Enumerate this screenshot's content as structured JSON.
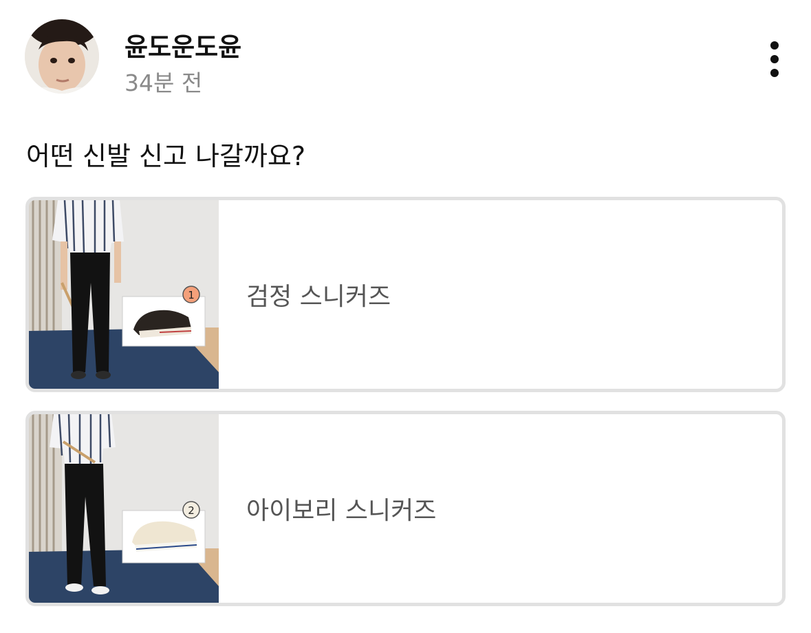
{
  "post": {
    "author": "윤도운도윤",
    "time_ago": "34분 전",
    "question": "어떤 신발 신고 나갈까요?"
  },
  "poll": {
    "options": [
      {
        "number": "1",
        "label": "검정 스니커즈",
        "shoe_color": "#2a2420",
        "badge_color": "#f4a07a"
      },
      {
        "number": "2",
        "label": "아이보리 스니커즈",
        "shoe_color": "#efe6d2",
        "badge_color": "#f3ede0"
      }
    ]
  },
  "icons": {
    "more": "vertical-ellipsis-icon"
  }
}
